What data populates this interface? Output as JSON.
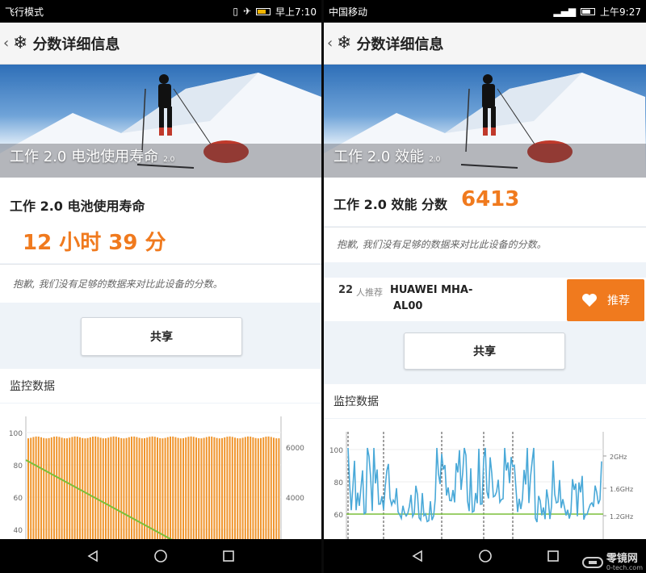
{
  "left": {
    "status": {
      "left": "飞行模式",
      "time": "早上7:10"
    },
    "appbar": {
      "back": "‹",
      "title": "分数详细信息"
    },
    "hero": {
      "caption": "工作 2.0 电池使用寿命",
      "version": "2.0"
    },
    "score": {
      "title": "工作 2.0 电池使用寿命",
      "value": "12 小时 39 分"
    },
    "note": "抱歉, 我们没有足够的数据来对比此设备的分数。",
    "share": "共享",
    "monitor": "监控数据",
    "chart_data": {
      "type": "bar",
      "left_ticks": [
        "100",
        "80",
        "60",
        "40"
      ],
      "right_ticks": [
        "6000",
        "4000"
      ],
      "bar_level": 97,
      "series": [
        {
          "name": "",
          "color": "#f0962e",
          "y_start": 83,
          "y_end": 40
        }
      ],
      "line_color": "#7bbf3a"
    }
  },
  "right": {
    "status": {
      "left": "中国移动",
      "time": "上午9:27"
    },
    "appbar": {
      "back": "‹",
      "title": "分数详细信息"
    },
    "hero": {
      "caption": "工作 2.0 效能",
      "version": "2.0"
    },
    "score": {
      "title": "工作 2.0 效能 分数",
      "value": "6413"
    },
    "note": "抱歉, 我们没有足够的数据来对比此设备的分数。",
    "recommend": {
      "count": "22",
      "count_label": "人推荐",
      "device_line1": "HUAWEI MHA-",
      "device_line2": "AL00",
      "button": "推荐"
    },
    "share": "共享",
    "monitor": "监控数据",
    "chart_data": {
      "type": "line",
      "left_ticks": [
        "100",
        "80",
        "60"
      ],
      "right_ticks": [
        "2GHz",
        "1.6GHz",
        "1.2GHz"
      ],
      "line_color": "#4aa9d8",
      "baseline_color": "#7bbf3a"
    }
  },
  "watermark": {
    "brand": "零镜网",
    "site": "0-tech.com"
  },
  "colors": {
    "accent": "#f07a1e"
  }
}
